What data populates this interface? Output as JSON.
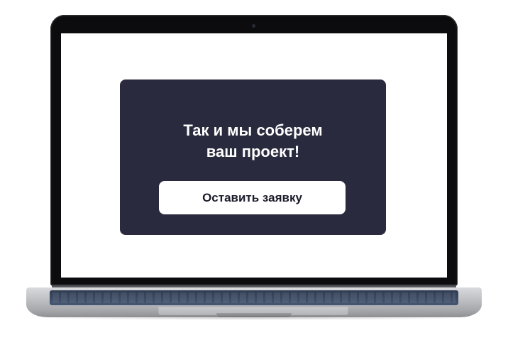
{
  "promo": {
    "title_line1": "Так и мы соберем",
    "title_line2": "ваш проект!",
    "cta_label": "Оставить заявку"
  },
  "colors": {
    "card_background": "#292a3d",
    "cta_background": "#ffffff",
    "cta_text": "#1b1c2b",
    "title_text": "#ffffff"
  }
}
